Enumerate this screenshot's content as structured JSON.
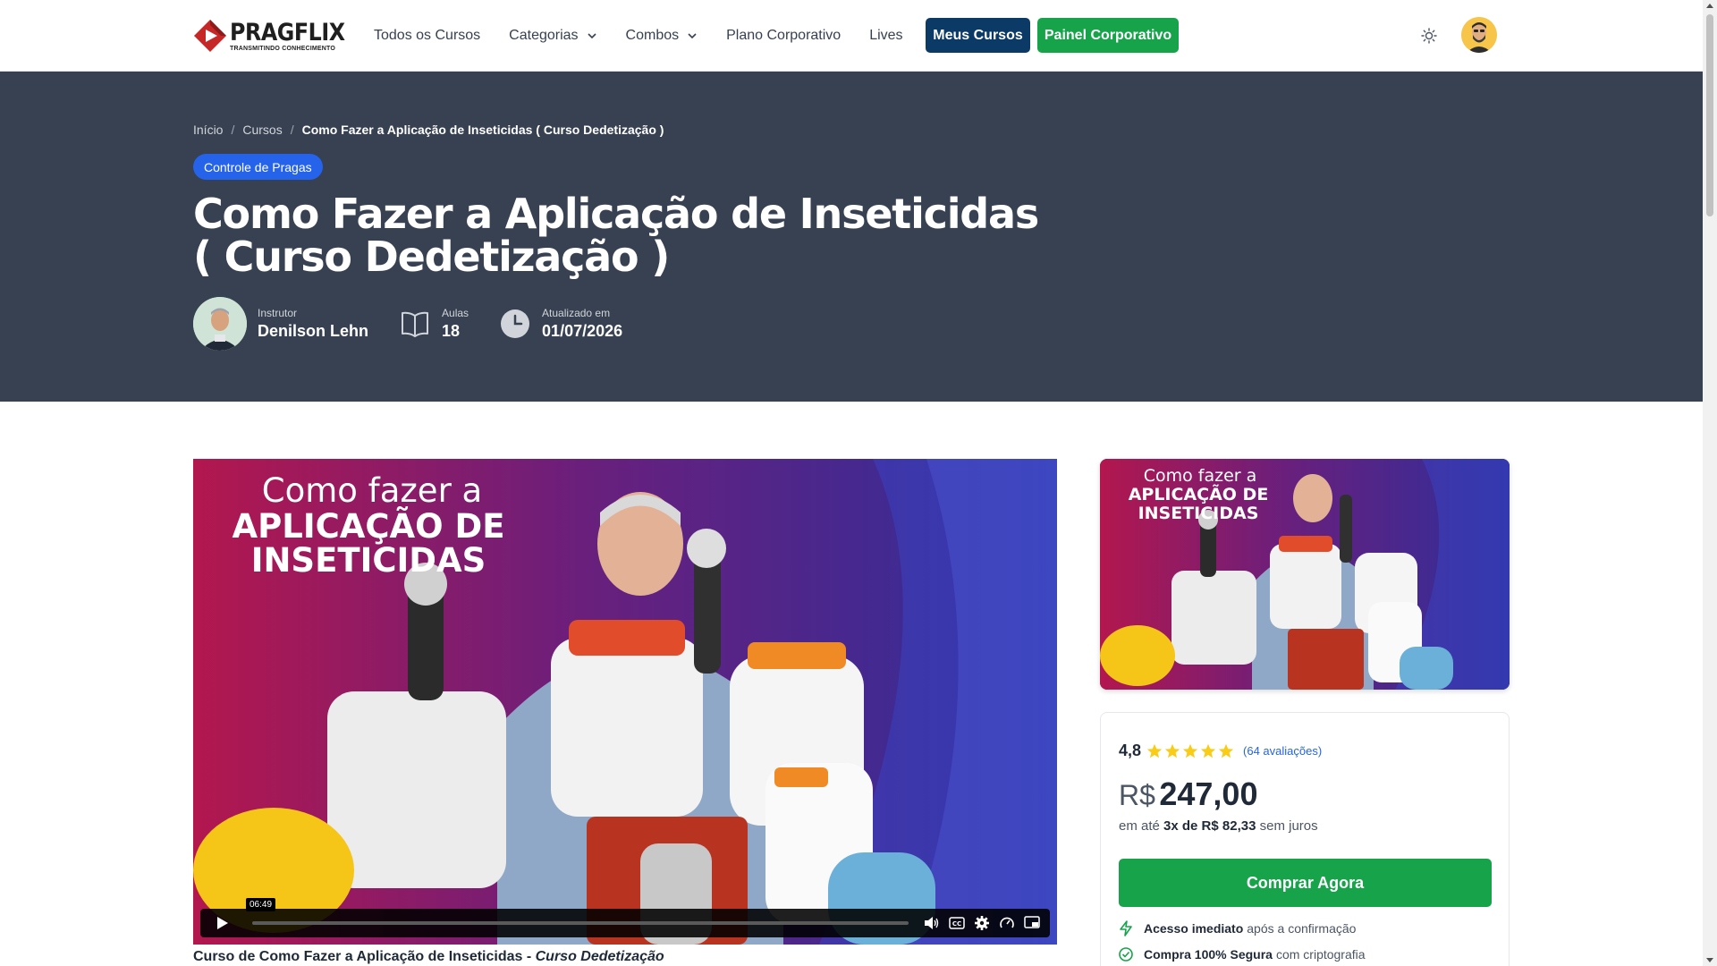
{
  "header": {
    "logo_name": "PRAGFLIX",
    "logo_tagline": "TRANSMITINDO CONHECIMENTO",
    "nav": [
      {
        "label": "Todos os Cursos",
        "dropdown": false
      },
      {
        "label": "Categorias",
        "dropdown": true
      },
      {
        "label": "Combos",
        "dropdown": true
      },
      {
        "label": "Plano Corporativo",
        "dropdown": false
      },
      {
        "label": "Lives",
        "dropdown": false
      }
    ],
    "meus_cursos": "Meus Cursos",
    "painel_corporativo": "Painel Corporativo",
    "theme_icon": "sun-icon",
    "avatar_icon": "user-avatar"
  },
  "hero": {
    "breadcrumb": [
      "Início",
      "Cursos",
      "Como Fazer a Aplicação de Inseticidas ( Curso Dedetização )"
    ],
    "category": "Controle de Pragas",
    "title": "Como Fazer a Aplicação de Inseticidas ( Curso Dedetização )",
    "instructor_label": "Instrutor",
    "instructor": "Denilson Lehn",
    "lessons_label": "Aulas",
    "lessons": "18",
    "updated_label": "Atualizado em",
    "updated": "01/07/2026"
  },
  "video": {
    "overlay_line1": "Como fazer a",
    "overlay_line2": "APLICAÇÃO DE",
    "overlay_line3": "INSETICIDAS",
    "time_tooltip": "06:49",
    "caption_main": "Curso de Como Fazer a Aplicação de Inseticidas - ",
    "caption_em": "Curso Dedetização",
    "controls": [
      "play-icon",
      "volume-icon",
      "captions-icon",
      "settings-icon",
      "speed-icon",
      "pip-icon"
    ]
  },
  "thumbnail": {
    "line1": "Como fazer a",
    "line2": "APLICAÇÃO DE",
    "line3": "INSETICIDAS"
  },
  "purchase": {
    "rating": "4,8",
    "stars": 5,
    "reviews": "(64 avaliações)",
    "currency": "R$",
    "price": "247,00",
    "install_prefix": "em até",
    "install_strong": "3x de R$ 82,33",
    "install_suffix": "sem juros",
    "buy_label": "Comprar Agora",
    "features": [
      {
        "strong": "Acesso imediato",
        "text": "após a confirmação",
        "icon": "bolt-icon"
      },
      {
        "strong": "Compra 100% Segura",
        "text": "com criptografia",
        "icon": "shield-check-icon"
      }
    ]
  },
  "colors": {
    "hero_bg": "#374151",
    "brand_blue": "#0b3a66",
    "green": "#16a34a",
    "badge_blue": "#2563eb",
    "star": "#facc15"
  }
}
